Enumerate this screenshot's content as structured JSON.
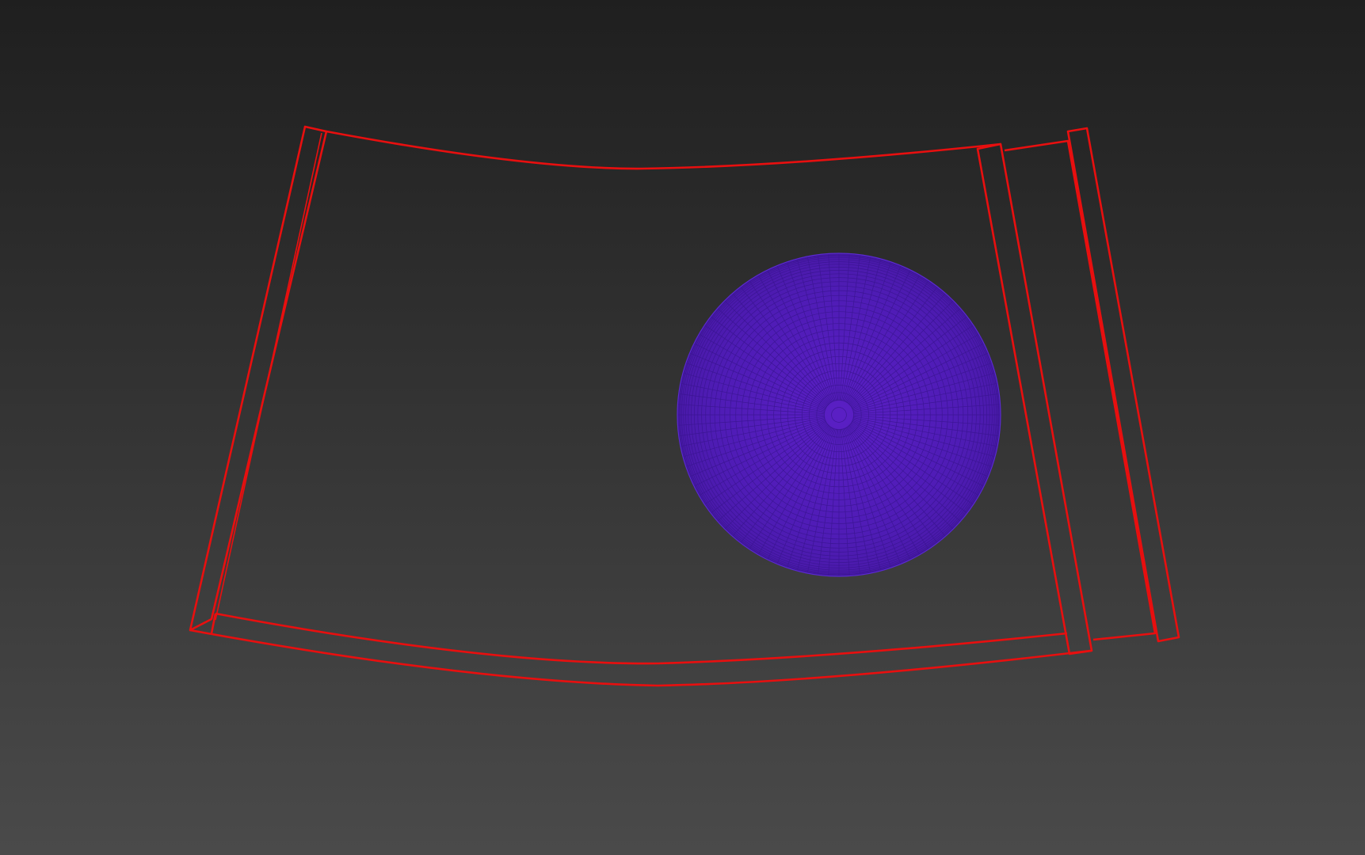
{
  "viewport": {
    "background_top": "#1f1f1f",
    "background_bottom": "#4a4a4a",
    "shading_mode": "wireframe"
  },
  "objects": [
    {
      "name": "curved-panel-wireframe",
      "type": "bent box",
      "color": "#e80f0f"
    },
    {
      "name": "sphere-wireframe",
      "type": "geosphere",
      "color": "#4f1cb6",
      "wire_color": "#3a1590"
    }
  ]
}
